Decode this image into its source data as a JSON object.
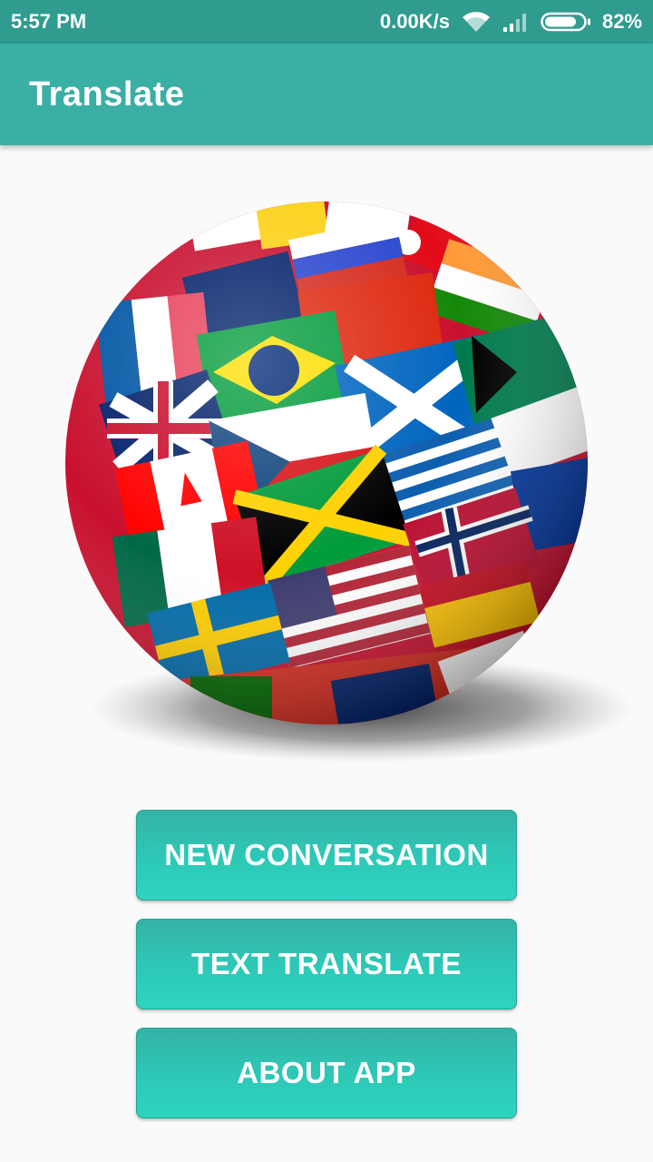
{
  "status_bar": {
    "time": "5:57 PM",
    "network_speed": "0.00K/s",
    "battery_percent": "82%",
    "wifi_icon": "wifi-icon",
    "signal_icon": "cell-signal-icon",
    "battery_icon": "battery-icon",
    "battery_level": 0.82
  },
  "app_bar": {
    "title": "Translate"
  },
  "hero": {
    "image": "flags-globe-illustration"
  },
  "buttons": {
    "new_conversation": "NEW CONVERSATION",
    "text_translate": "TEXT TRANSLATE",
    "about_app": "ABOUT APP"
  },
  "colors": {
    "status_bar": "#2f9c8f",
    "app_bar": "#3aafa4",
    "button": "#2dc9b7",
    "background": "#fafafa"
  }
}
